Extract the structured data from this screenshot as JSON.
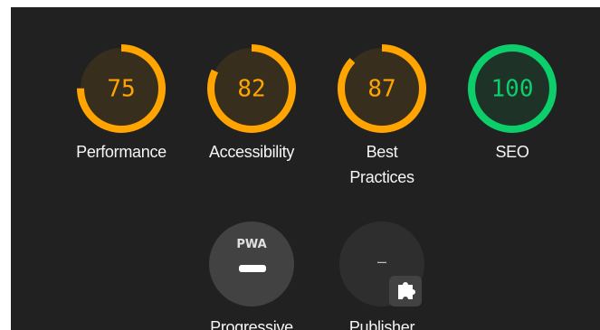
{
  "colors": {
    "average": "#ffa400",
    "pass": "#0cce6b",
    "neutral_gauge": "#424242",
    "panel_background": "#212121"
  },
  "categories": [
    {
      "label": "Performance",
      "score": "75",
      "value": 0.75
    },
    {
      "label": "Accessibility",
      "score": "82",
      "value": 0.82
    },
    {
      "label_lines": [
        "Best",
        "Practices"
      ],
      "score": "87",
      "value": 0.87
    },
    {
      "label": "SEO",
      "score": "100",
      "value": 1.0
    }
  ],
  "pwa": {
    "badge_text": "PWA",
    "icon": "pwa-badge-icon",
    "label_line1": "Progressive"
  },
  "plugins": {
    "score": "–",
    "icon": "plugin-puzzle-icon",
    "label_line1": "Publisher"
  }
}
